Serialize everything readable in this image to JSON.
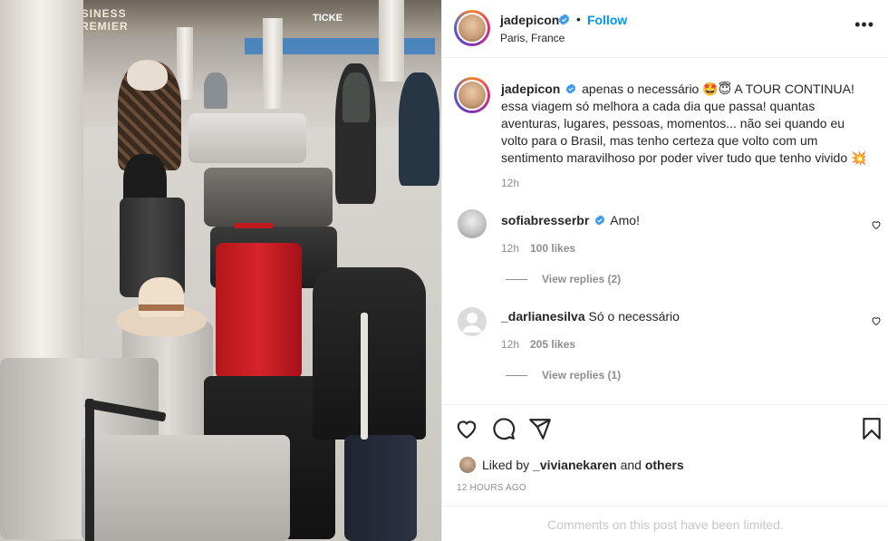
{
  "photo": {
    "sign_left": "USINESS PREMIER",
    "sign_right": "TICKE",
    "description_name": "post-photo"
  },
  "header": {
    "username": "jadepicon",
    "follow_label": "Follow",
    "separator": "•",
    "location": "Paris, France",
    "more": "•••"
  },
  "caption": {
    "username": "jadepicon",
    "text": "apenas o necessário 🤩😇 A TOUR CONTINUA! essa viagem só melhora a cada dia que passa! quantas aventuras, lugares, pessoas, momentos... não sei quando eu volto para o Brasil, mas tenho certeza que volto com um sentimento maravilhoso por poder viver tudo que tenho vivido 💥",
    "time": "12h"
  },
  "comments": [
    {
      "username": "sofiabresserbr",
      "text": "Amo!",
      "time": "12h",
      "likes": "100 likes",
      "replies": "View replies (2)"
    },
    {
      "username": "_darlianesilva",
      "text": "Só o necessário",
      "time": "12h",
      "likes": "205 likes",
      "replies": "View replies (1)"
    }
  ],
  "actions": {
    "liked_by_prefix": "Liked by",
    "liked_by_user": "_vivianekaren",
    "liked_by_and": "and",
    "liked_by_others": "others",
    "time_ago": "12 HOURS AGO",
    "limited": "Comments on this post have been limited."
  },
  "icons": [
    "more-icon",
    "verified-icon",
    "heart-icon",
    "comment-icon",
    "share-icon",
    "save-icon"
  ],
  "colors": {
    "follow": "#0095f6",
    "verified": "#3897f0",
    "muted": "#8e8e8e",
    "border": "#efefef"
  }
}
